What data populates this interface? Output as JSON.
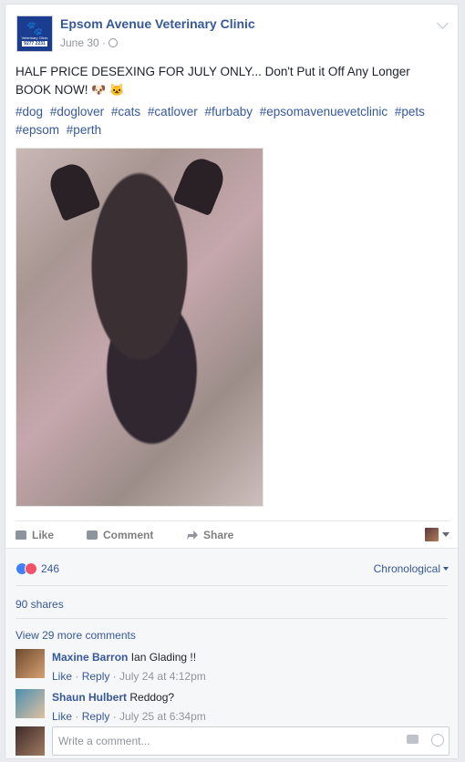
{
  "post": {
    "page_name": "Epsom Avenue Veterinary Clinic",
    "date": "June 30 ·",
    "text_line1": "HALF PRICE DESEXING FOR JULY ONLY... Don't Put it Off Any Longer",
    "text_line2": "BOOK NOW!",
    "emoji1": "🐶",
    "emoji2": "🐱",
    "hashtags": [
      "#dog",
      "#doglover",
      "#cats",
      "#catlover",
      "#furbaby",
      "#epsomavenuevetclinic",
      "#pets",
      "#epsom",
      "#perth"
    ],
    "logo_text": {
      "sub": "Veterinary Clinic",
      "phone": "9277 2231"
    }
  },
  "actions": {
    "like": "Like",
    "comment": "Comment",
    "share": "Share"
  },
  "reactions": {
    "count": "246",
    "sort_label": "Chronological"
  },
  "shares": "90 shares",
  "view_more": "View 29 more comments",
  "comments": [
    {
      "author": "Maxine Barron",
      "text": "Ian Glading !!",
      "like": "Like",
      "reply": "Reply",
      "time": "July 24 at 4:12pm"
    },
    {
      "author": "Shaun Hulbert",
      "text": "Reddog?",
      "like": "Like",
      "reply": "Reply",
      "time": "July 25 at 6:34pm"
    }
  ],
  "composer": {
    "placeholder": "Write a comment..."
  },
  "colors": {
    "link": "#365899",
    "muted": "#90949c",
    "background": "#e9ebee"
  },
  "icons": [
    "globe-icon",
    "chevron-down-icon",
    "like-icon",
    "comment-icon",
    "share-icon",
    "camera-icon",
    "smiley-icon"
  ]
}
